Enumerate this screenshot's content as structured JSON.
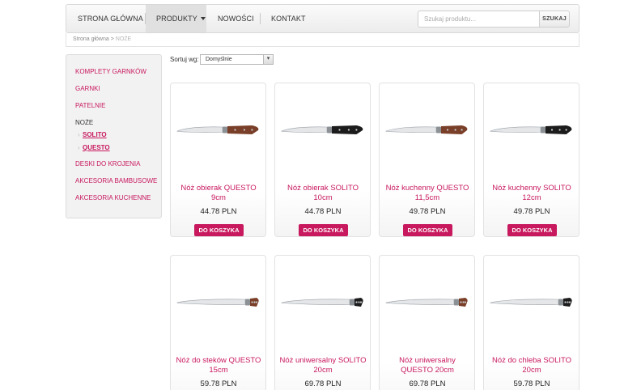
{
  "nav": {
    "items": [
      {
        "label": "STRONA GŁÓWNA"
      },
      {
        "label": "PRODUKTY"
      },
      {
        "label": "NOWOŚCI"
      },
      {
        "label": "KONTAKT"
      }
    ],
    "search_placeholder": "Szukaj produktu...",
    "search_button": "SZUKAJ"
  },
  "breadcrumb": {
    "home": "Strona główna",
    "separator": ">",
    "current": "NOŻE"
  },
  "sidebar": {
    "items": [
      {
        "label": "KOMPLETY GARNKÓW"
      },
      {
        "label": "GARNKI"
      },
      {
        "label": "PATELNIE"
      },
      {
        "label": "NOŻE"
      },
      {
        "label": "DESKI DO KROJENIA"
      },
      {
        "label": "AKCESORIA BAMBUSOWE"
      },
      {
        "label": "AKCESORIA KUCHENNE"
      }
    ],
    "subitems": [
      {
        "label": "SOLITO"
      },
      {
        "label": "QUESTO"
      }
    ]
  },
  "sort": {
    "label": "Sortuj wg:",
    "selected": "Domyślnie"
  },
  "products": [
    {
      "name": "Nóż obierak QUESTO 9cm",
      "price": "44.78 PLN",
      "cart": "DO KOSZYKA",
      "handle": "wood",
      "blade": "short"
    },
    {
      "name": "Nóż obierak SOLITO 10cm",
      "price": "44.78 PLN",
      "cart": "DO KOSZYKA",
      "handle": "black",
      "blade": "short"
    },
    {
      "name": "Nóż kuchenny QUESTO 11,5cm",
      "price": "49.78 PLN",
      "cart": "DO KOSZYKA",
      "handle": "wood",
      "blade": "medium"
    },
    {
      "name": "Nóż kuchenny SOLITO 12cm",
      "price": "49.78 PLN",
      "cart": "DO KOSZYKA",
      "handle": "black",
      "blade": "medium"
    },
    {
      "name": "Nóż do steków QUESTO 15cm",
      "price": "59.78 PLN",
      "cart": "DO KOSZYKA",
      "handle": "wood",
      "blade": "long"
    },
    {
      "name": "Nóż uniwersalny SOLITO 20cm",
      "price": "69.78 PLN",
      "cart": "DO KOSZYKA",
      "handle": "black",
      "blade": "long"
    },
    {
      "name": "Nóż uniwersalny QUESTO 20cm",
      "price": "69.78 PLN",
      "cart": "DO KOSZYKA",
      "handle": "wood",
      "blade": "long"
    },
    {
      "name": "Nóż do chleba SOLITO 20cm",
      "price": "59.78 PLN",
      "cart": "DO KOSZYKA",
      "handle": "black",
      "blade": "long"
    }
  ],
  "colors": {
    "accent": "#c8185e",
    "wood_handle": "#7a3f28",
    "black_handle": "#1c1c1c"
  }
}
